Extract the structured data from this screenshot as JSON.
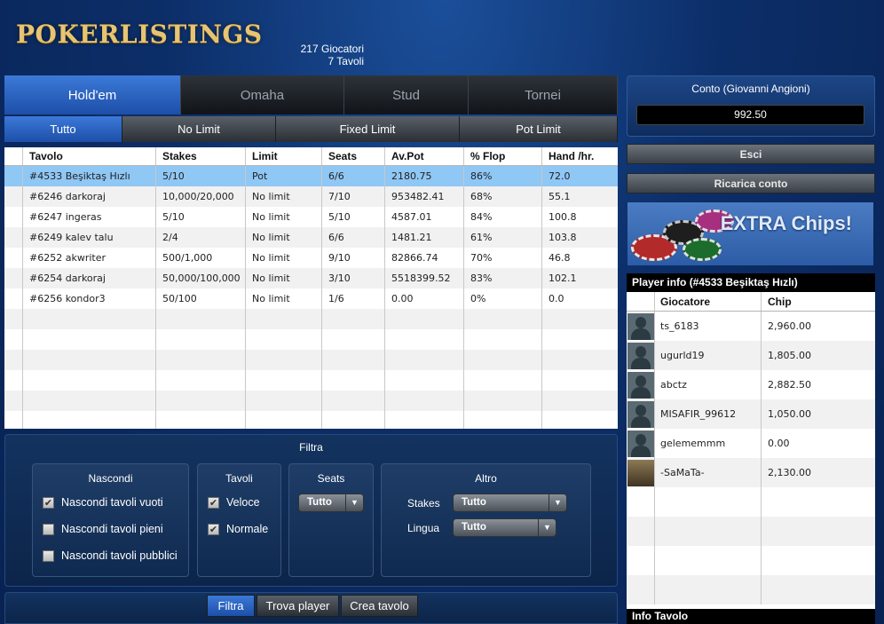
{
  "header": {
    "logo_text": "POKERLISTINGS",
    "players_count": "217 Giocatori",
    "tables_count": "7 Tavoli"
  },
  "game_tabs": [
    {
      "label": "Hold'em",
      "active": true
    },
    {
      "label": "Omaha",
      "active": false
    },
    {
      "label": "Stud",
      "active": false
    },
    {
      "label": "Tornei",
      "active": false
    }
  ],
  "limit_tabs": [
    {
      "label": "Tutto",
      "active": true
    },
    {
      "label": "No Limit",
      "active": false
    },
    {
      "label": "Fixed Limit",
      "active": false
    },
    {
      "label": "Pot Limit",
      "active": false
    }
  ],
  "table_list": {
    "columns": [
      "Tavolo",
      "Stakes",
      "Limit",
      "Seats",
      "Av.Pot",
      "% Flop",
      "Hand /hr."
    ],
    "rows": [
      [
        "#4533 Beşiktaş Hızlı",
        "5/10",
        "Pot",
        "6/6",
        "2180.75",
        "86%",
        "72.0"
      ],
      [
        "#6246 darkoraj",
        "10,000/20,000",
        "No limit",
        "7/10",
        "953482.41",
        "68%",
        "55.1"
      ],
      [
        "#6247 ingeras",
        "5/10",
        "No limit",
        "5/10",
        "4587.01",
        "84%",
        "100.8"
      ],
      [
        "#6249 kalev talu",
        "2/4",
        "No limit",
        "6/6",
        "1481.21",
        "61%",
        "103.8"
      ],
      [
        "#6252 akwriter",
        "500/1,000",
        "No limit",
        "9/10",
        "82866.74",
        "70%",
        "46.8"
      ],
      [
        "#6254 darkoraj",
        "50,000/100,000",
        "No limit",
        "3/10",
        "5518399.52",
        "83%",
        "102.1"
      ],
      [
        "#6256 kondor3",
        "50/100",
        "No limit",
        "1/6",
        "0.00",
        "0%",
        "0.0"
      ]
    ],
    "selected_row": 0,
    "empty_rows": 6
  },
  "filter": {
    "title": "Filtra",
    "hide": {
      "title": "Nascondi",
      "options": [
        {
          "label": "Nascondi tavoli vuoti",
          "checked": true
        },
        {
          "label": "Nascondi tavoli pieni",
          "checked": false
        },
        {
          "label": "Nascondi tavoli pubblici",
          "checked": false
        }
      ]
    },
    "tables": {
      "title": "Tavoli",
      "options": [
        {
          "label": "Veloce",
          "checked": true
        },
        {
          "label": "Normale",
          "checked": true
        }
      ]
    },
    "seats": {
      "title": "Seats",
      "value": "Tutto"
    },
    "other": {
      "title": "Altro",
      "stakes_label": "Stakes",
      "stakes_value": "Tutto",
      "language_label": "Lingua",
      "language_value": "Tutto"
    }
  },
  "bottom_buttons": [
    {
      "label": "Filtra",
      "active": true
    },
    {
      "label": "Trova player",
      "active": false
    },
    {
      "label": "Crea tavolo",
      "active": false
    }
  ],
  "account": {
    "title": "Conto (Giovanni Angioni)",
    "balance": "992.50",
    "logout_label": "Esci",
    "recharge_label": "Ricarica conto"
  },
  "promo": {
    "text": "EXTRA Chips!"
  },
  "player_info": {
    "title": "Player info (#4533 Beşiktaş Hızlı)",
    "columns": [
      "Giocatore",
      "Chip"
    ],
    "players": [
      {
        "name": "ts_6183",
        "chips": "2,960.00",
        "avatar": "default"
      },
      {
        "name": "ugurld19",
        "chips": "1,805.00",
        "avatar": "default"
      },
      {
        "name": "abctz",
        "chips": "2,882.50",
        "avatar": "default"
      },
      {
        "name": "MISAFIR_99612",
        "chips": "1,050.00",
        "avatar": "default"
      },
      {
        "name": "gelememmm",
        "chips": "0.00",
        "avatar": "default"
      },
      {
        "name": "-SaMaTa-",
        "chips": "2,130.00",
        "avatar": "photo"
      }
    ],
    "empty_rows": 4
  },
  "table_info_title": "Info Tavolo",
  "colors": {
    "accent_blue": "#2f67c4",
    "selected_row": "#8fc7f5",
    "logo_gold": "#e7c472"
  }
}
